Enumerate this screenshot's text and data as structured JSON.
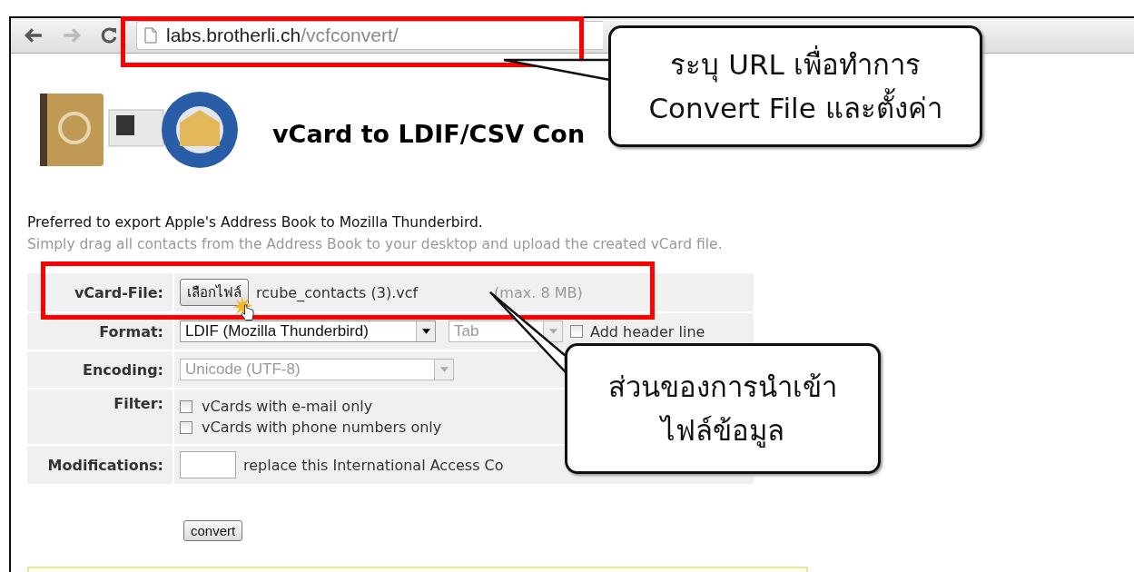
{
  "browser": {
    "url_host": "labs.brotherli.ch",
    "url_path": "/vcfconvert/"
  },
  "page": {
    "title": "vCard to LDIF/CSV Con",
    "intro": "Preferred to export Apple's Address Book to Mozilla Thunderbird.",
    "hint": "Simply drag all contacts from the Address Book to your desktop and upload the created vCard file."
  },
  "file_row": {
    "label": "vCard-File:",
    "button": "เลือกไฟล์",
    "file_name": "rcube_contacts (3).vcf",
    "limit": "(max. 8 MB)"
  },
  "format_row": {
    "label": "Format:",
    "format": "LDIF (Mozilla Thunderbird)",
    "delimiter": {
      "value": "Tab",
      "disabled": true
    },
    "header_line": {
      "label": "Add header line",
      "checked": false
    }
  },
  "encoding_row": {
    "label": "Encoding:",
    "value": "Unicode (UTF-8)",
    "disabled": true
  },
  "filter_row": {
    "label": "Filter:",
    "options": [
      {
        "label": "vCards with e-mail only",
        "checked": false
      },
      {
        "label": "vCards with phone numbers only",
        "checked": false
      }
    ]
  },
  "modifications_row": {
    "label": "Modifications:",
    "text": "replace this International Access Co"
  },
  "submit": "convert",
  "callouts": [
    {
      "lines": [
        "ระบุ URL เพื่อทำการ",
        "Convert File และตั้งค่า"
      ]
    },
    {
      "lines": [
        "ส่วนของการนำเข้า",
        "ไฟล์ข้อมูล"
      ]
    }
  ]
}
